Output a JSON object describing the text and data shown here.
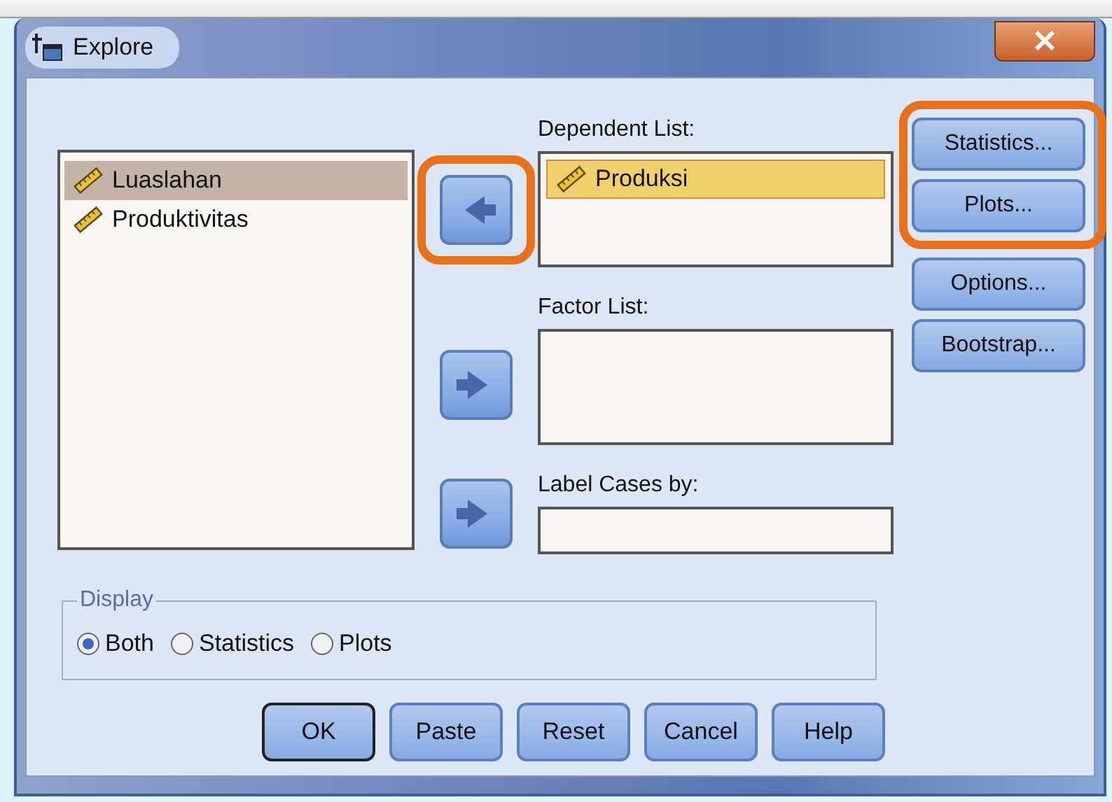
{
  "window": {
    "title": "Explore"
  },
  "source_list": {
    "items": [
      {
        "label": "Luaslahan",
        "selected": true
      },
      {
        "label": "Produktivitas",
        "selected": false
      }
    ]
  },
  "move_buttons": [
    {
      "kind": "left",
      "highlighted": true
    },
    {
      "kind": "right",
      "highlighted": false
    },
    {
      "kind": "right",
      "highlighted": false
    }
  ],
  "target_lists": [
    {
      "label": "Dependent List:",
      "kind": "list",
      "items": [
        {
          "label": "Produksi",
          "selected": true
        }
      ]
    },
    {
      "label": "Factor List:",
      "kind": "list"
    },
    {
      "label": "Label Cases by:",
      "kind": "field"
    }
  ],
  "side_buttons": [
    {
      "label": "Statistics...",
      "highlighted": true
    },
    {
      "label": "Plots...",
      "highlighted": true
    },
    {
      "label": "Options...",
      "highlighted": false
    },
    {
      "label": "Bootstrap...",
      "highlighted": false
    }
  ],
  "display": {
    "title": "Display",
    "options": [
      {
        "label": "Both",
        "selected": true
      },
      {
        "label": "Statistics",
        "selected": false
      },
      {
        "label": "Plots",
        "selected": false
      }
    ]
  },
  "buttons": [
    {
      "label": "OK",
      "default": true
    },
    {
      "label": "Paste",
      "default": false
    },
    {
      "label": "Reset",
      "default": false
    },
    {
      "label": "Cancel",
      "default": false
    },
    {
      "label": "Help",
      "default": false
    }
  ]
}
